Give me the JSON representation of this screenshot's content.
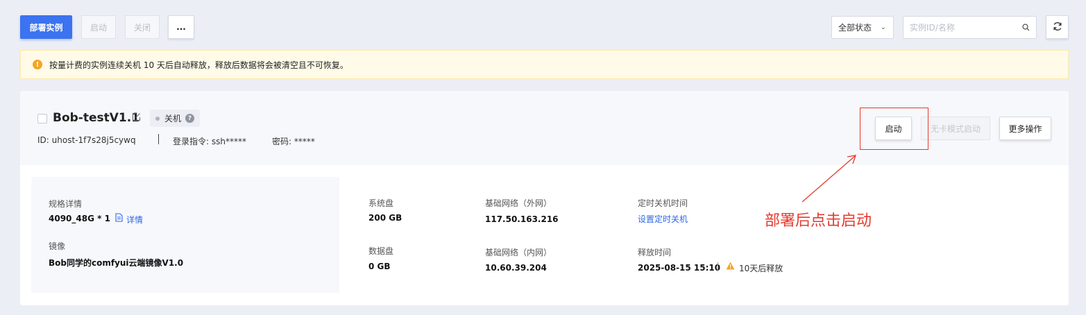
{
  "toolbar": {
    "deploy_label": "部署实例",
    "start_label": "启动",
    "stop_label": "关闭",
    "more_label": "...",
    "status_filter": "全部状态",
    "search_placeholder": "实例ID/名称"
  },
  "notice": {
    "text": "按量计费的实例连续关机 10 天后自动释放，释放后数据将会被清空且不可恢复。"
  },
  "instance": {
    "name": "Bob-testV1.1",
    "status": "关机",
    "id": "ID: uhost-1f7s28j5cywq",
    "login": "登录指令: ssh*****",
    "password": "密码: *****",
    "actions": {
      "start": "启动",
      "no_card_start": "无卡模式启动",
      "more_ops": "更多操作"
    },
    "spec": {
      "label": "规格详情",
      "value": "4090_48G * 1",
      "detail_link": "详情"
    },
    "image": {
      "label": "镜像",
      "value": "Bob同学的comfyui云端镜像V1.0"
    },
    "system_disk": {
      "label": "系统盘",
      "value": "200 GB"
    },
    "data_disk": {
      "label": "数据盘",
      "value": "0 GB"
    },
    "public_net": {
      "label": "基础网络（外网）",
      "value": "117.50.163.216"
    },
    "private_net": {
      "label": "基础网络（内网）",
      "value": "10.60.39.204"
    },
    "shutdown_timer": {
      "label": "定时关机时间",
      "link": "设置定时关机"
    },
    "release": {
      "label": "释放时间",
      "value": "2025-08-15 15:10",
      "note": "10天后释放"
    }
  },
  "annotation": {
    "text": "部署后点击启动",
    "color": "#e53a2e"
  },
  "colors": {
    "primary": "#3b73f0",
    "link": "#2e66e6",
    "warning": "#f5a623"
  }
}
